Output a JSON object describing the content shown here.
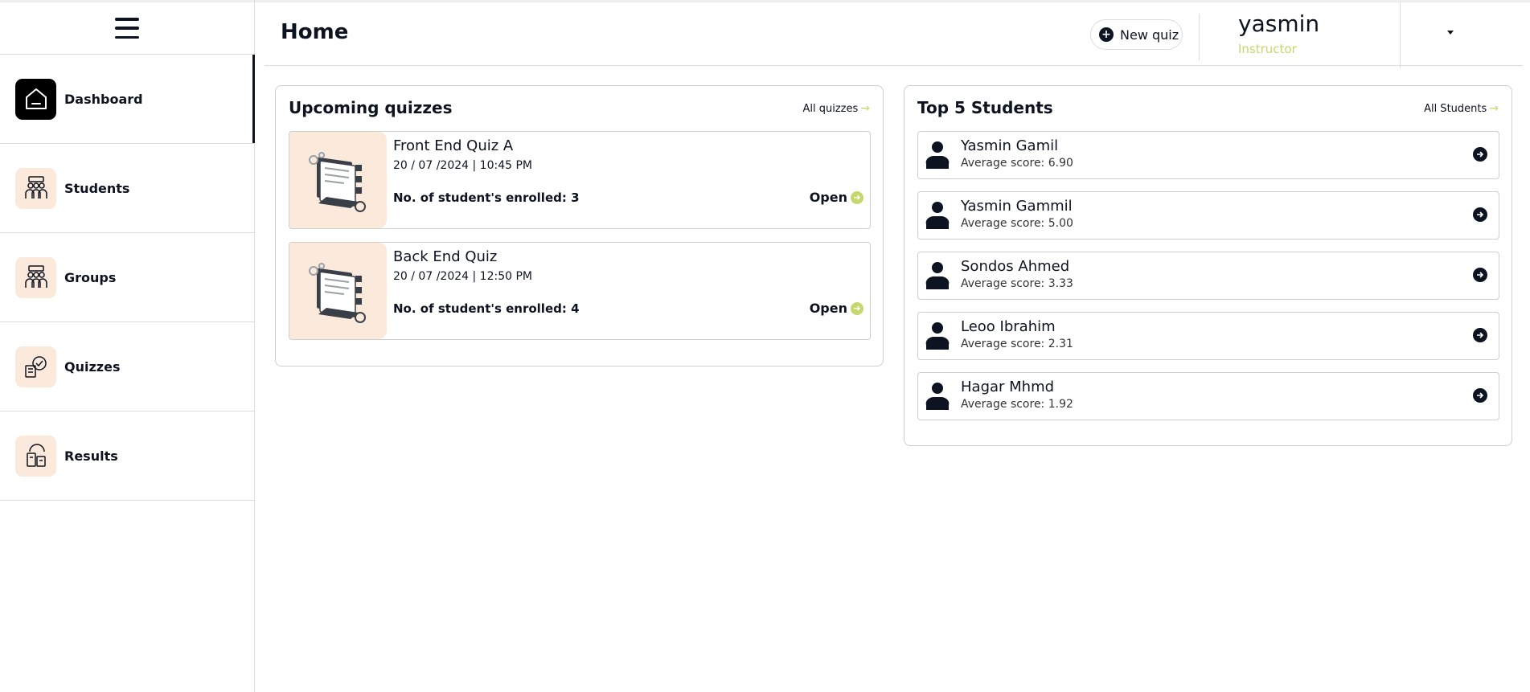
{
  "sidebar": {
    "menu_icon": "hamburger-menu-icon",
    "items": [
      {
        "label": "Dashboard",
        "icon": "home-icon",
        "active": true
      },
      {
        "label": "Students",
        "icon": "students-icon",
        "active": false
      },
      {
        "label": "Groups",
        "icon": "groups-icon",
        "active": false
      },
      {
        "label": "Quizzes",
        "icon": "quizzes-icon",
        "active": false
      },
      {
        "label": "Results",
        "icon": "results-icon",
        "active": false
      }
    ]
  },
  "header": {
    "title": "Home",
    "new_quiz_label": "New quiz",
    "user_name": "yasmin",
    "user_role": "Instructor"
  },
  "quizzes_panel": {
    "title": "Upcoming quizzes",
    "link_label": "All quizzes",
    "items": [
      {
        "title": "Front End Quiz A",
        "date": "20 / 07 /2024 | 10:45 PM",
        "enrolled": "No. of student's enrolled: 3",
        "action": "Open"
      },
      {
        "title": "Back End Quiz",
        "date": "20 / 07 /2024 | 12:50 PM",
        "enrolled": "No. of student's enrolled: 4",
        "action": "Open"
      }
    ]
  },
  "students_panel": {
    "title": "Top 5 Students",
    "link_label": "All Students",
    "items": [
      {
        "name": "Yasmin Gamil",
        "score": "Average score: 6.90"
      },
      {
        "name": "Yasmin Gammil",
        "score": "Average score: 5.00"
      },
      {
        "name": "Sondos Ahmed",
        "score": "Average score: 3.33"
      },
      {
        "name": "Leoo Ibrahim",
        "score": "Average score: 2.31"
      },
      {
        "name": "Hagar Mhmd",
        "score": "Average score: 1.92"
      }
    ]
  },
  "colors": {
    "accent": "#c5d86d",
    "dark": "#0d1321",
    "icon_bg": "#fbeadb"
  }
}
